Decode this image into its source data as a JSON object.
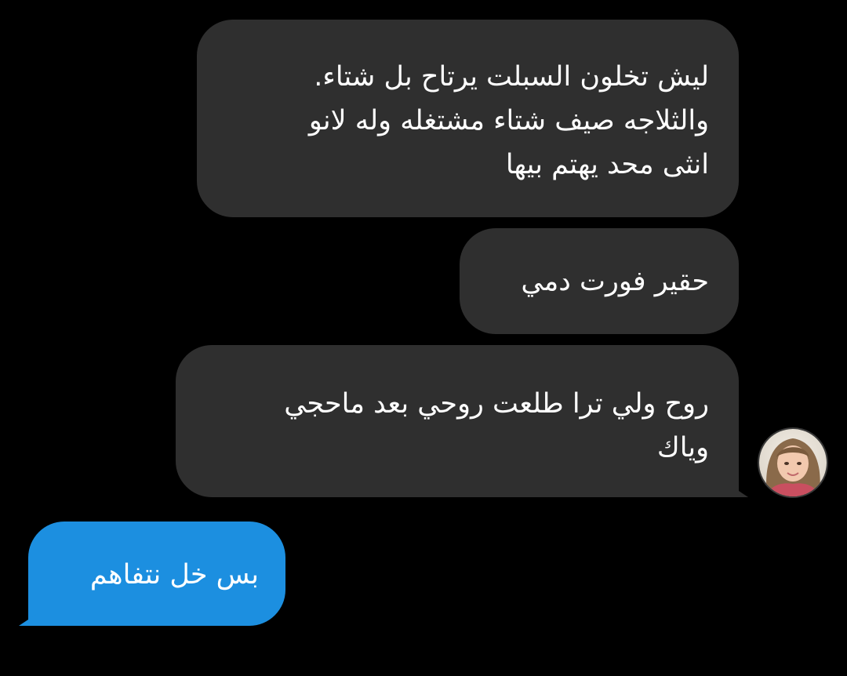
{
  "conversation": {
    "messages": [
      {
        "direction": "incoming",
        "text": "ليش تخلون السبلت يرتاح بل شتاء.\nوالثلاجه صيف شتاء مشتغله وله لانو\nانثى محد يهتم بيها"
      },
      {
        "direction": "incoming",
        "text": "حقير فورت دمي"
      },
      {
        "direction": "incoming",
        "text": "روح ولي ترا طلعت روحي بعد ماحجي\nوياك"
      },
      {
        "direction": "outgoing",
        "text": "بس خل نتفاهم"
      }
    ],
    "sender_avatar": {
      "icon": "contact-avatar-photo"
    }
  },
  "colors": {
    "background": "#000000",
    "incoming_bubble": "#2f2f2f",
    "outgoing_bubble": "#1c8fe0",
    "text": "#ffffff"
  }
}
